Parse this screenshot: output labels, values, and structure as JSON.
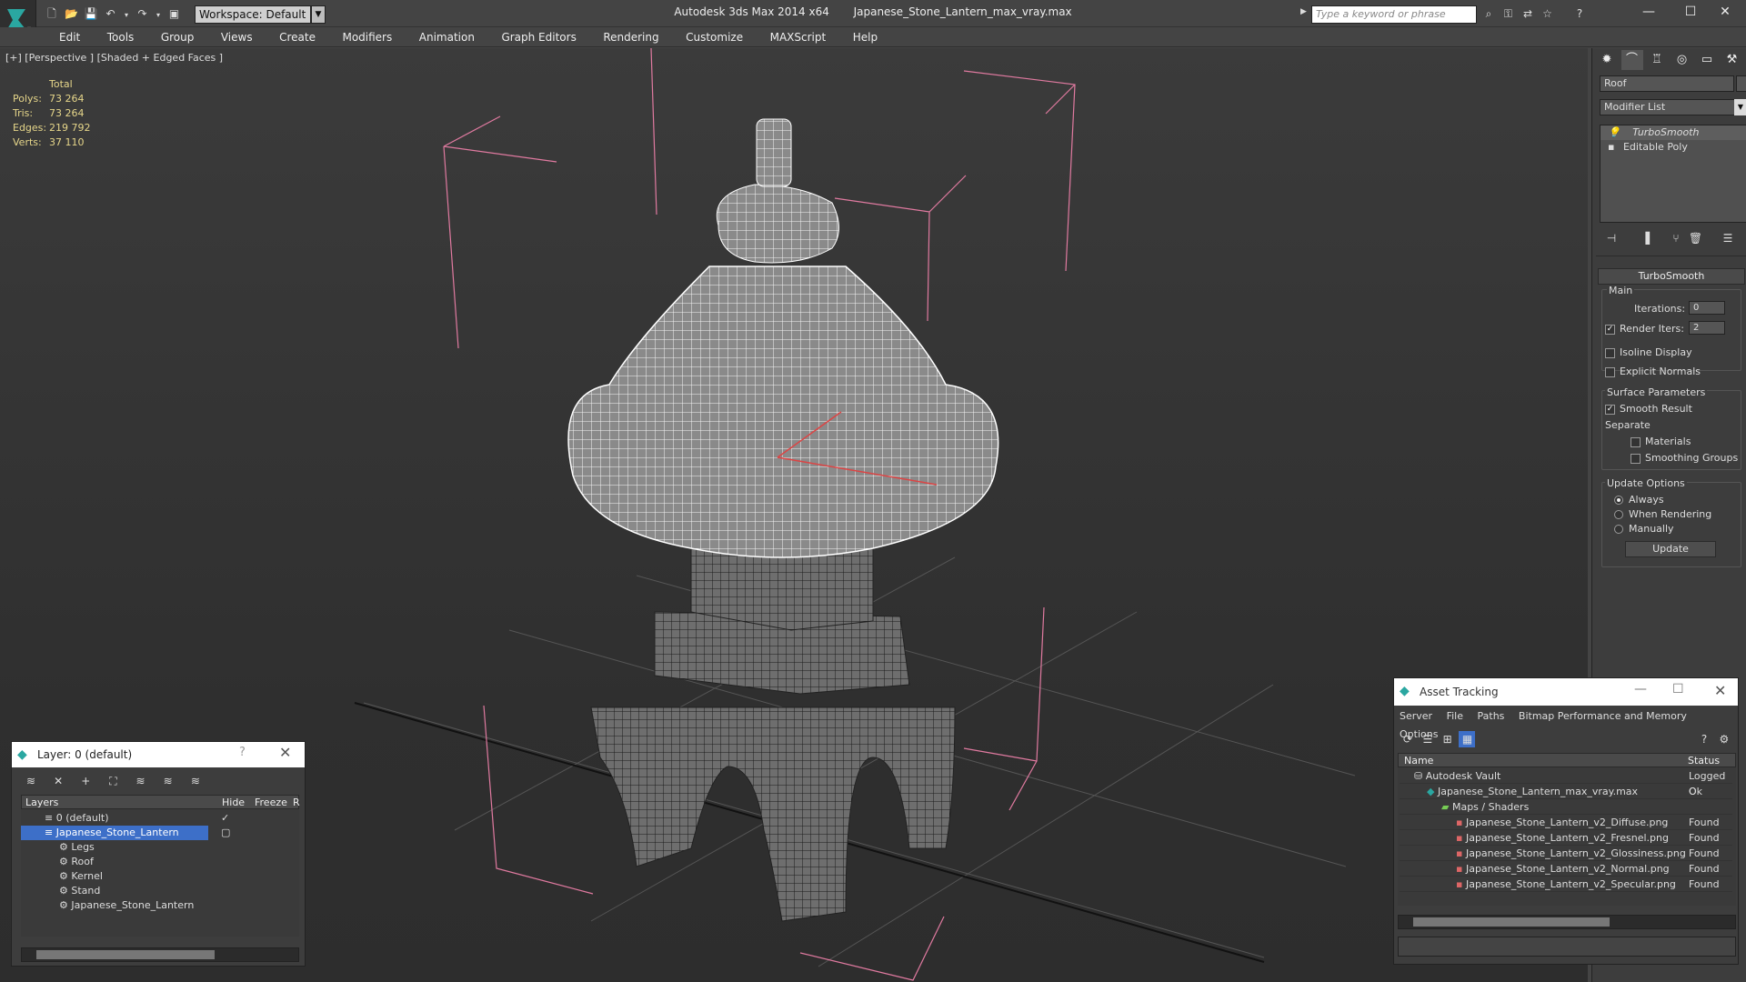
{
  "titlebar": {
    "workspace": "Workspace: Default",
    "app_title": "Autodesk 3ds Max  2014 x64",
    "file_name": "Japanese_Stone_Lantern_max_vray.max",
    "search_placeholder": "Type a keyword or phrase"
  },
  "menu": [
    "Edit",
    "Tools",
    "Group",
    "Views",
    "Create",
    "Modifiers",
    "Animation",
    "Graph Editors",
    "Rendering",
    "Customize",
    "MAXScript",
    "Help"
  ],
  "viewport": {
    "label": "[+] [Perspective ] [Shaded + Edged Faces ]",
    "stats_header": "Total",
    "stats": [
      {
        "label": "Polys:",
        "value": "73 264"
      },
      {
        "label": "Tris:",
        "value": "73 264"
      },
      {
        "label": "Edges:",
        "value": "219 792"
      },
      {
        "label": "Verts:",
        "value": "37 110"
      }
    ]
  },
  "command_panel": {
    "object_name": "Roof",
    "modifier_list": "Modifier List",
    "stack": [
      "TurboSmooth",
      "Editable Poly"
    ],
    "rollout_title": "TurboSmooth",
    "main_label": "Main",
    "iterations_label": "Iterations:",
    "iterations_value": "0",
    "render_iters_label": "Render Iters:",
    "render_iters_value": "2",
    "isoline": "Isoline Display",
    "explicit_normals": "Explicit Normals",
    "surface_params": "Surface Parameters",
    "smooth_result": "Smooth Result",
    "separate": "Separate",
    "materials": "Materials",
    "smoothing_groups": "Smoothing Groups",
    "update_options": "Update Options",
    "always": "Always",
    "when_rendering": "When Rendering",
    "manually": "Manually",
    "update_button": "Update"
  },
  "layer_window": {
    "title": "Layer: 0 (default)",
    "col_layers": "Layers",
    "col_hide": "Hide",
    "col_freeze": "Freeze",
    "col_r": "R",
    "rows": [
      "0 (default)",
      "Japanese_Stone_Lantern",
      "Legs",
      "Roof",
      "Kernel",
      "Stand",
      "Japanese_Stone_Lantern"
    ]
  },
  "asset_window": {
    "title": "Asset Tracking",
    "menu": [
      "Server",
      "File",
      "Paths",
      "Bitmap Performance and Memory",
      "Options"
    ],
    "col_name": "Name",
    "col_status": "Status",
    "rows": [
      {
        "name": "Autodesk Vault",
        "status": "Logged O"
      },
      {
        "name": "Japanese_Stone_Lantern_max_vray.max",
        "status": "Ok"
      },
      {
        "name": "Maps / Shaders",
        "status": ""
      },
      {
        "name": "Japanese_Stone_Lantern_v2_Diffuse.png",
        "status": "Found"
      },
      {
        "name": "Japanese_Stone_Lantern_v2_Fresnel.png",
        "status": "Found"
      },
      {
        "name": "Japanese_Stone_Lantern_v2_Glossiness.png",
        "status": "Found"
      },
      {
        "name": "Japanese_Stone_Lantern_v2_Normal.png",
        "status": "Found"
      },
      {
        "name": "Japanese_Stone_Lantern_v2_Specular.png",
        "status": "Found"
      }
    ]
  }
}
